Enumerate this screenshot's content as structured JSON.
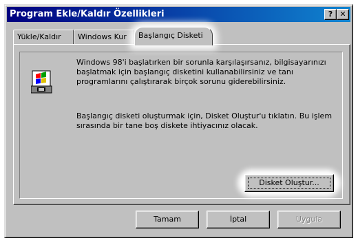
{
  "window": {
    "title": "Program Ekle/Kaldır Özellikleri",
    "help_label": "?",
    "close_label": "✕"
  },
  "tabs": [
    {
      "label": "Yükle/Kaldır"
    },
    {
      "label": "Windows Kur"
    },
    {
      "label": "Başlangıç Disketi"
    }
  ],
  "content": {
    "paragraph1": "Windows 98'i başlatırken bir sorunla karşılaşırsanız, bilgisayarınızı başlatmak için başlangıç disketini kullanabilirsiniz ve tanı programlarını çalıştırarak birçok sorunu giderebilirsiniz.",
    "paragraph2": "Başlangıç disketi oluşturmak için, Disket Oluştur'u tıklatın. Bu işlem sırasında bir tane boş diskete ihtiyacınız olacak.",
    "create_disk_label": "Disket Oluştur..."
  },
  "footer": {
    "ok_label": "Tamam",
    "cancel_label": "İptal",
    "apply_label": "Uygula"
  },
  "colors": {
    "titlebar_start": "#000080",
    "titlebar_end": "#1084d0",
    "face": "#c0c0c0"
  },
  "icons": [
    "windows-setup-icon",
    "help-icon",
    "close-icon"
  ]
}
